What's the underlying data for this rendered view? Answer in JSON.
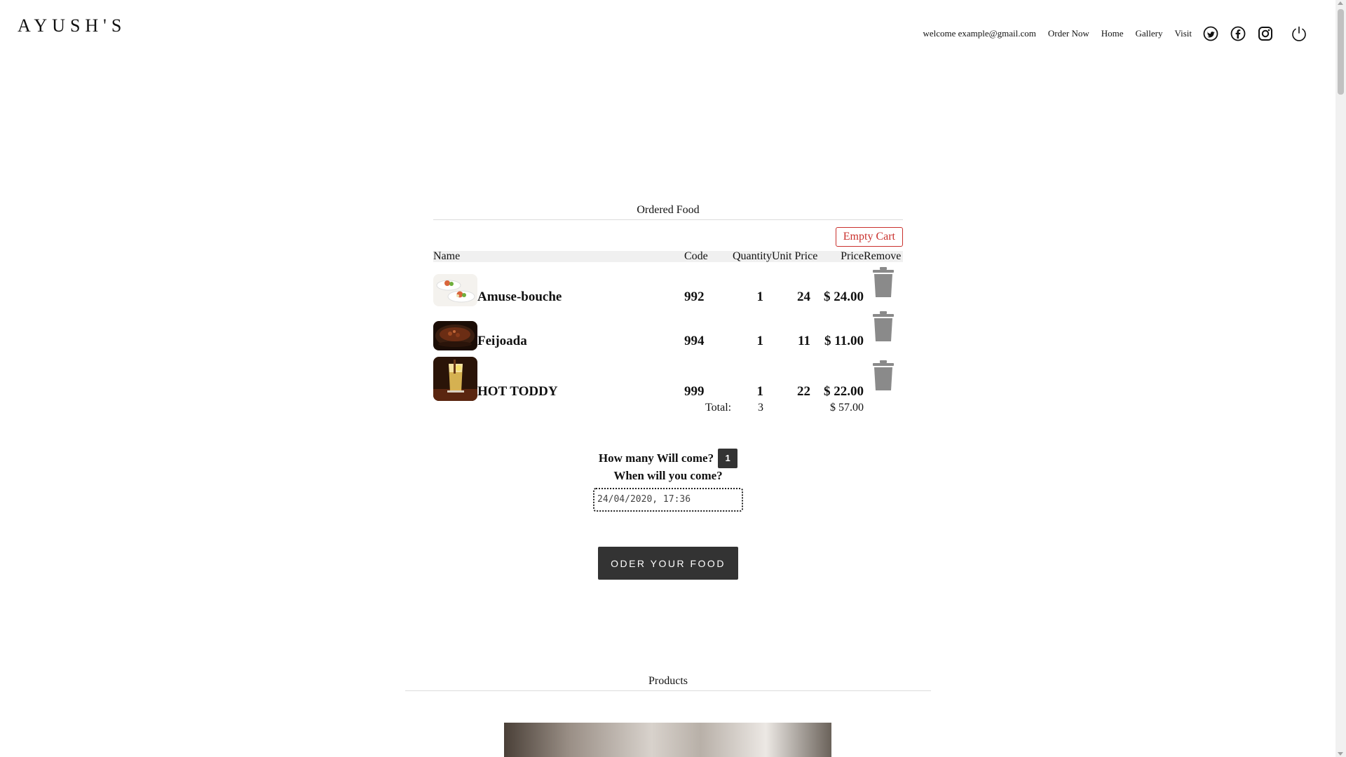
{
  "header": {
    "logo": "AYUSH'S",
    "welcome": "welcome example@gmail.com",
    "nav": [
      "Order Now",
      "Home",
      "Gallery",
      "Visit"
    ],
    "icons": [
      "twitter-icon",
      "facebook-icon",
      "instagram-icon",
      "power-icon"
    ]
  },
  "cart": {
    "title": "Ordered Food",
    "empty_label": "Empty Cart",
    "columns": {
      "name": "Name",
      "code": "Code",
      "qty": "Quantity",
      "unit": "Unit Price",
      "price": "Price",
      "remove": "Remove"
    },
    "items": [
      {
        "name": "Amuse-bouche",
        "code": "992",
        "qty": "1",
        "unit": "24",
        "price": "$ 24.00"
      },
      {
        "name": "Feijoada",
        "code": "994",
        "qty": "1",
        "unit": "11",
        "price": "$ 11.00"
      },
      {
        "name": "HOT TODDY",
        "code": "999",
        "qty": "1",
        "unit": "22",
        "price": "$ 22.00"
      }
    ],
    "total_label": "Total:",
    "total_qty": "3",
    "total_price": "$ 57.00"
  },
  "booking": {
    "guests_label": "How many Will come?",
    "guests_value": "1",
    "when_label": "When will you come?",
    "datetime_value": "24/04/2020, 17:36",
    "order_button": "ODER YOUR FOOD"
  },
  "products": {
    "title": "Products"
  },
  "colors": {
    "danger": "#c9302c",
    "dark_button": "#333333"
  }
}
